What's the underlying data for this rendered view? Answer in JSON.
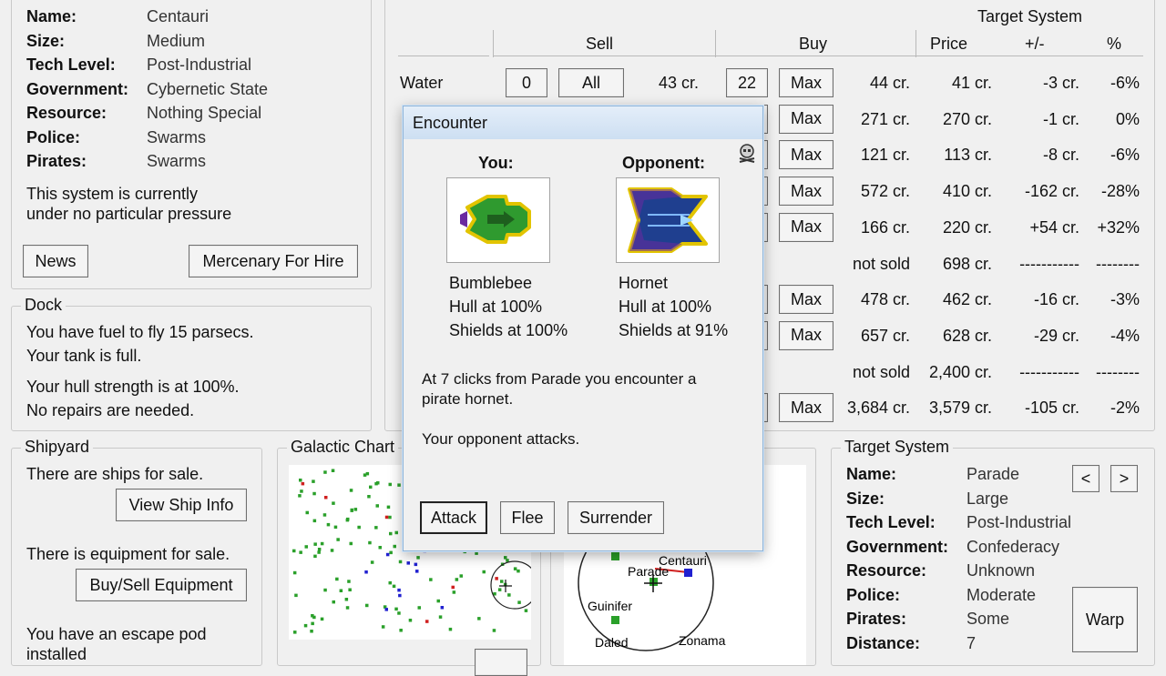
{
  "system": {
    "rows": [
      {
        "label": "Name:",
        "value": "Centauri"
      },
      {
        "label": "Size:",
        "value": "Medium"
      },
      {
        "label": "Tech Level:",
        "value": "Post-Industrial"
      },
      {
        "label": "Government:",
        "value": "Cybernetic State"
      },
      {
        "label": "Resource:",
        "value": "Nothing Special"
      },
      {
        "label": "Police:",
        "value": "Swarms"
      },
      {
        "label": "Pirates:",
        "value": "Swarms"
      }
    ],
    "status_line1": "This system is currently",
    "status_line2": "under no particular pressure",
    "news_button": "News",
    "mercenary_button": "Mercenary For Hire"
  },
  "dock": {
    "title": "Dock",
    "fuel": "You have fuel to fly 15 parsecs.",
    "tank": "Your tank is full.",
    "hull": "Your hull strength is at 100%.",
    "repairs": "No repairs are needed."
  },
  "shipyard": {
    "title": "Shipyard",
    "ships_text": "There are ships for sale.",
    "view_ship_button": "View Ship Info",
    "equipment_text": "There is equipment for sale.",
    "equipment_button": "Buy/Sell Equipment",
    "escape_line1": "You have an escape pod",
    "escape_line2": "installed"
  },
  "galactic_chart": {
    "title": "Galactic Chart"
  },
  "short_range": {
    "labels": [
      "Centauri",
      "Parade",
      "Guinifer",
      "Daled",
      "Zonama"
    ]
  },
  "trade": {
    "target_system_header": "Target System",
    "headers": {
      "sell": "Sell",
      "buy": "Buy",
      "price": "Price",
      "diff": "+/-",
      "pct": "%"
    },
    "rows": [
      {
        "name": "Water",
        "sell_qty": "0",
        "sell_all": "All",
        "sell_price": "43 cr.",
        "buy_qty": "22",
        "buy_max": "Max",
        "buy_price": "44 cr.",
        "target": "41 cr.",
        "diff": "-3 cr.",
        "pct": "-6%"
      },
      {
        "name": "",
        "buy_max": "Max",
        "buy_price": "271 cr.",
        "target": "270 cr.",
        "diff": "-1 cr.",
        "pct": "0%"
      },
      {
        "name": "",
        "buy_max": "Max",
        "buy_price": "121 cr.",
        "target": "113 cr.",
        "diff": "-8 cr.",
        "pct": "-6%"
      },
      {
        "name": "",
        "buy_max": "Max",
        "buy_price": "572 cr.",
        "target": "410 cr.",
        "diff": "-162 cr.",
        "pct": "-28%"
      },
      {
        "name": "",
        "buy_max": "Max",
        "buy_price": "166 cr.",
        "target": "220 cr.",
        "diff": "+54 cr.",
        "pct": "+32%"
      },
      {
        "name": "",
        "buy_max": "",
        "buy_price": "not sold",
        "target": "698 cr.",
        "diff": "-----------",
        "pct": "--------"
      },
      {
        "name": "",
        "buy_max": "Max",
        "buy_price": "478 cr.",
        "target": "462 cr.",
        "diff": "-16 cr.",
        "pct": "-3%"
      },
      {
        "name": "",
        "buy_max": "Max",
        "buy_price": "657 cr.",
        "target": "628 cr.",
        "diff": "-29 cr.",
        "pct": "-4%"
      },
      {
        "name": "",
        "buy_max": "",
        "buy_price": "not sold",
        "target": "2,400 cr.",
        "diff": "-----------",
        "pct": "--------"
      },
      {
        "name": "",
        "buy_max": "Max",
        "buy_price": "3,684 cr.",
        "target": "3,579 cr.",
        "diff": "-105 cr.",
        "pct": "-2%"
      }
    ]
  },
  "target_system": {
    "title": "Target System",
    "rows": [
      {
        "label": "Name:",
        "value": "Parade"
      },
      {
        "label": "Size:",
        "value": "Large"
      },
      {
        "label": "Tech Level:",
        "value": "Post-Industrial"
      },
      {
        "label": "Government:",
        "value": "Confederacy"
      },
      {
        "label": "Resource:",
        "value": "Unknown"
      },
      {
        "label": "Police:",
        "value": "Moderate"
      },
      {
        "label": "Pirates:",
        "value": "Some"
      },
      {
        "label": "Distance:",
        "value": "7"
      }
    ],
    "prev_button": "<",
    "next_button": ">",
    "warp_button": "Warp"
  },
  "encounter": {
    "title": "Encounter",
    "you_label": "You:",
    "opponent_label": "Opponent:",
    "you_ship": "Bumblebee",
    "you_hull": "Hull at 100%",
    "you_shields": "Shields at 100%",
    "opp_ship": "Hornet",
    "opp_hull": "Hull at 100%",
    "opp_shields": "Shields at 91%",
    "message_line1": "At 7 clicks from Parade you encounter a",
    "message_line2": "pirate hornet.",
    "attack_message": "Your opponent attacks.",
    "attack_button": "Attack",
    "flee_button": "Flee",
    "surrender_button": "Surrender",
    "icon": "pirate-skull-icon"
  },
  "colors": {
    "accent": "#1f3f8f",
    "system_dot": "#2aa02a",
    "player": "#2020d0",
    "danger": "#d02020"
  }
}
